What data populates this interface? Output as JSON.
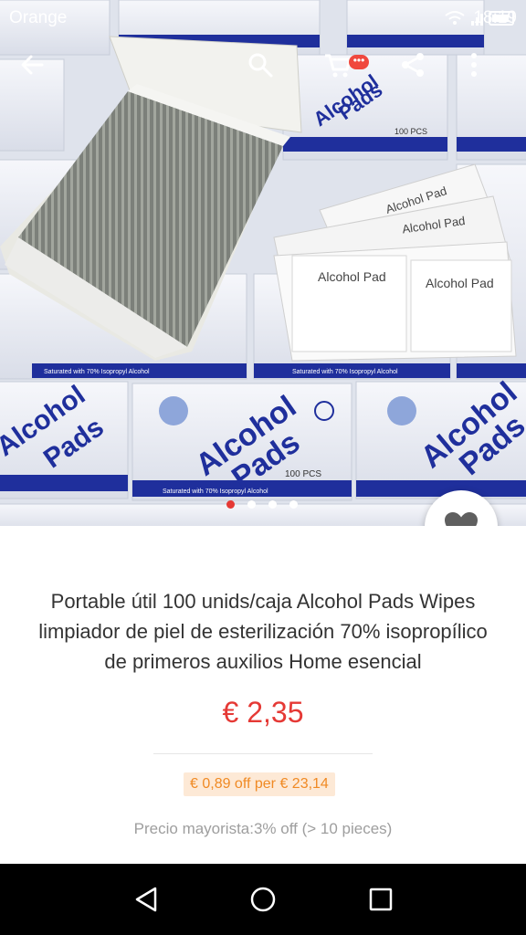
{
  "status_bar": {
    "carrier": "Orange",
    "time": "18:19"
  },
  "hero": {
    "box_print": {
      "brand_line1": "Alcohol",
      "brand_line2": "Pads",
      "count": "100 PCS",
      "strap": "Saturated with 70% Isopropyl Alcohol",
      "pad_label": "Alcohol Pad"
    }
  },
  "app_bar": {
    "back_icon": "arrow-back-icon",
    "search_icon": "search-icon",
    "cart_icon": "cart-icon",
    "cart_badge": "•••",
    "share_icon": "share-icon",
    "more_icon": "more-vert-icon"
  },
  "carousel": {
    "pages": 4,
    "active_index": 0
  },
  "product": {
    "title": "Portable útil 100 unids/caja Alcohol Pads Wipes limpiador de piel de esterilización 70% isopropílico de primeros auxilios Home esencial",
    "price": "€ 2,35",
    "coupon": "€ 0,89 off per € 23,14",
    "wholesale": "Precio mayorista:3% off (> 10 pieces)"
  },
  "colors": {
    "accent": "#e53935",
    "coupon_bg": "#fde9d6",
    "coupon_text": "#f08a24",
    "box_blue": "#1f2f9c"
  }
}
